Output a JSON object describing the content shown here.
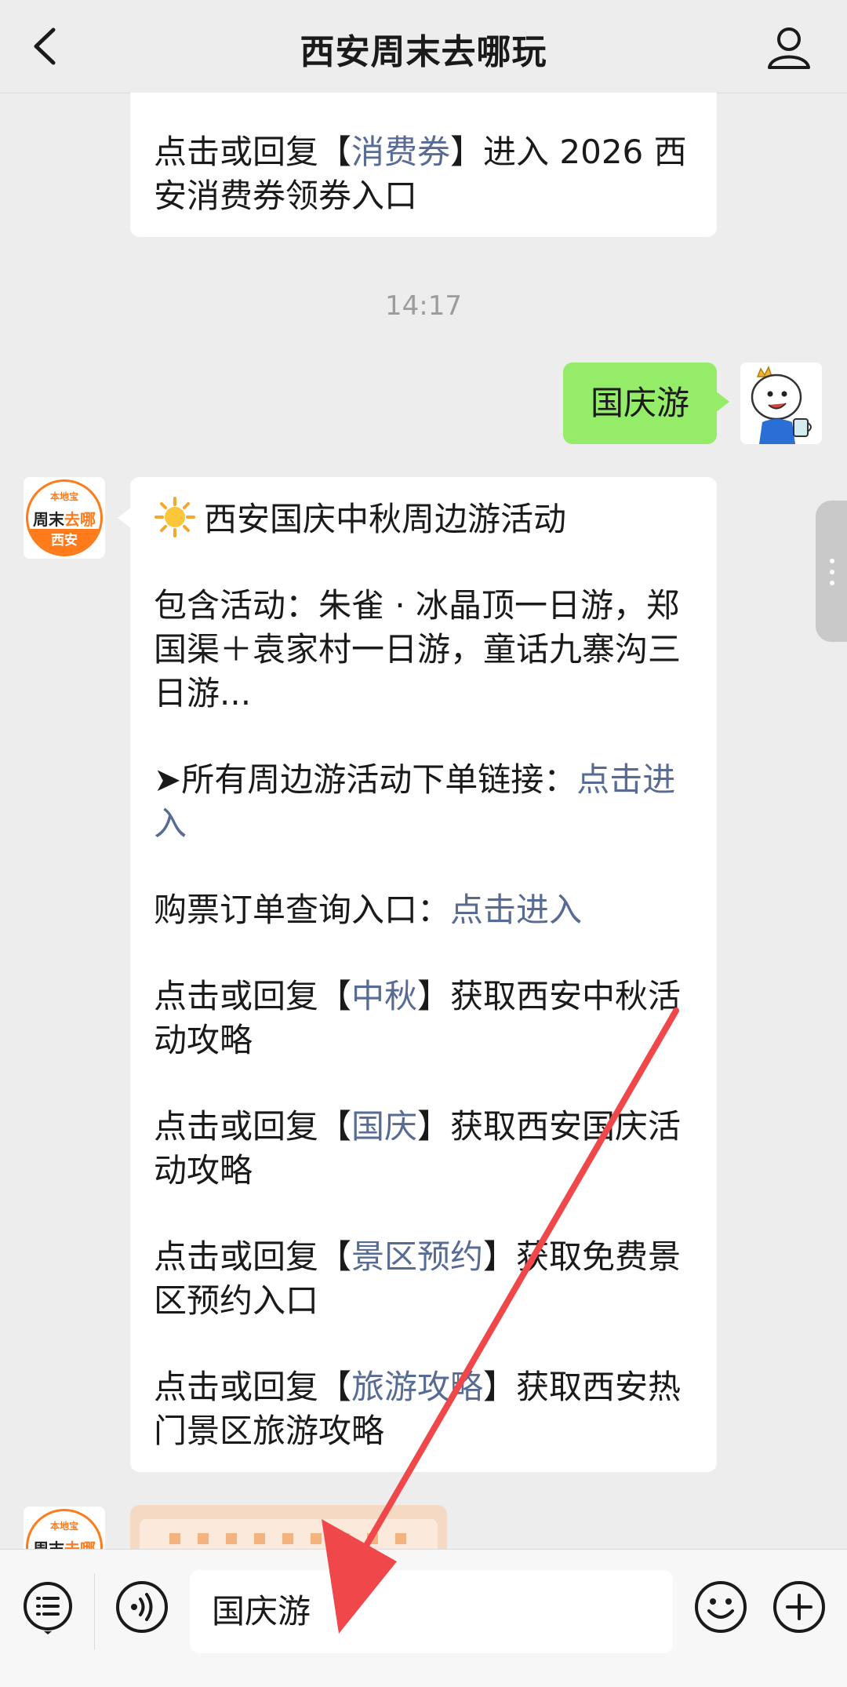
{
  "header": {
    "back_icon": "back-arrow-icon",
    "title": "西安周末去哪玩",
    "user_icon": "user-profile-icon"
  },
  "messages": {
    "first": {
      "pre": "点击或回复【",
      "link": "消费券",
      "post": "】进入 2026 西安消费券领券入口"
    },
    "timestamp": "14:17",
    "sent": "国庆游",
    "reply": {
      "sun_icon": "sun-icon",
      "heading": "西安国庆中秋周边游活动",
      "includes": "包含活动：朱雀 · 冰晶顶一日游，郑国渠＋袁家村一日游，童话九寨沟三日游...",
      "order_prefix": "➤所有周边游活动下单链接：",
      "order_link": "点击进入",
      "ticket_prefix": "购票订单查询入口：",
      "ticket_link": "点击进入",
      "items": [
        {
          "pre": "点击或回复【",
          "link": "中秋",
          "post": "】获取西安中秋活动攻略"
        },
        {
          "pre": "点击或回复【",
          "link": "国庆",
          "post": "】获取西安国庆活动攻略"
        },
        {
          "pre": "点击或回复【",
          "link": "景区预约",
          "post": "】获取免费景区预约入口"
        },
        {
          "pre": "点击或回复【",
          "link": "旅游攻略",
          "post": "】获取西安热门景区旅游攻略"
        }
      ]
    }
  },
  "bot_avatar": {
    "top": "本地宝",
    "mid_a": "周末",
    "mid_b": "去哪",
    "bottom": "西安"
  },
  "input_bar": {
    "menu_icon": "menu-list-icon",
    "voice_icon": "voice-icon",
    "value": "国庆游",
    "emoji_icon": "emoji-icon",
    "plus_icon": "plus-icon"
  },
  "colors": {
    "link": "#576b95",
    "sent_bubble": "#95ec69",
    "annotation_arrow": "#f0474b",
    "brand_orange": "#ff7a1a"
  }
}
